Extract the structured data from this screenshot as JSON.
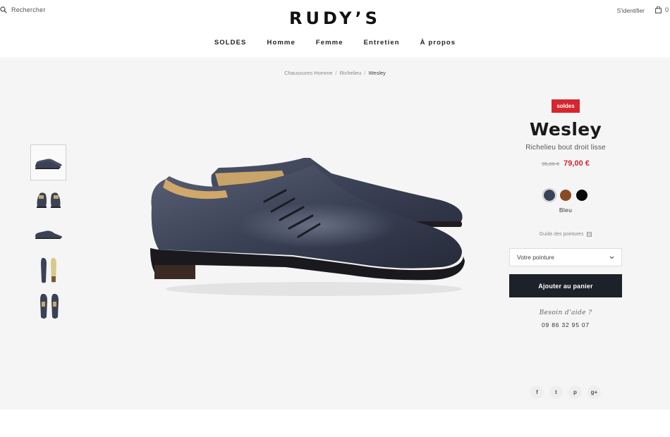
{
  "header": {
    "search_label": "Rechercher",
    "logo": "RUDY’S",
    "login_label": "S'identifier",
    "cart_count": "0"
  },
  "nav": [
    "SOLDES",
    "Homme",
    "Femme",
    "Entretien",
    "À propos"
  ],
  "breadcrumb": {
    "items": [
      "Chaussures Homme",
      "Richelieu"
    ],
    "current": "Wesley"
  },
  "thumbnails": [
    {
      "view": "side-pair",
      "active": true
    },
    {
      "view": "front-pair",
      "active": false
    },
    {
      "view": "side-single",
      "active": false
    },
    {
      "view": "sole-view",
      "active": false
    },
    {
      "view": "top-view",
      "active": false
    }
  ],
  "product": {
    "badge": "soldes",
    "name": "Wesley",
    "subtitle": "Richelieu bout droit lisse",
    "old_price": "95,00 €",
    "price": "79,00 €",
    "colors": [
      {
        "name": "Bleu",
        "hex": "#3a4257",
        "selected": true
      },
      {
        "name": "Cognac",
        "hex": "#8b4a23",
        "selected": false
      },
      {
        "name": "Noir",
        "hex": "#0a0a0a",
        "selected": false
      }
    ],
    "selected_color": "Bleu",
    "size_guide": "Guide des pointures",
    "size_placeholder": "Votre pointure",
    "add_to_cart": "Ajouter au panier",
    "help_title": "Besoin d'aide ?",
    "phone": "09 86 32 95 07"
  },
  "social": [
    {
      "icon": "facebook-icon",
      "glyph": "f"
    },
    {
      "icon": "twitter-icon",
      "glyph": "t"
    },
    {
      "icon": "pinterest-icon",
      "glyph": "p"
    },
    {
      "icon": "google-plus-icon",
      "glyph": "g+"
    }
  ],
  "colors": {
    "accent_red": "#d6262c",
    "button_dark": "#1d2129",
    "page_grey": "#f5f5f6",
    "shoe_navy": "#3b4256"
  }
}
